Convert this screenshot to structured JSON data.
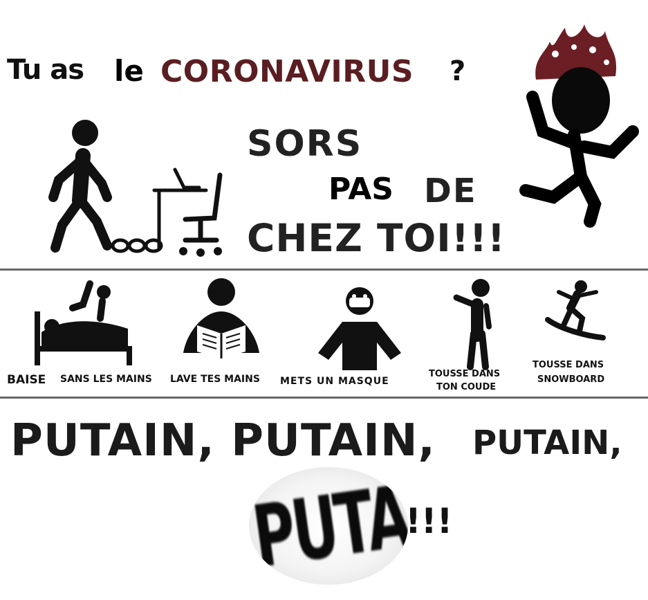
{
  "title": {
    "tu_as": "Tu as",
    "le": "le",
    "coronavirus": "CORONAVIRUS",
    "question_mark": "?"
  },
  "slogan": {
    "sors": "SORS",
    "pas": "PAS",
    "de": "DE",
    "chez_toi": "CHEZ TOI!!!"
  },
  "captions": {
    "baise": "BAISE",
    "sans_les_mains": "SANS LES MAINS",
    "lave_tes_mains": "LAVE TES MAINS",
    "mets_un_masque": "METS UN MASQUE",
    "tousse_dans_ton_coude_line1": "TOUSSE DANS",
    "tousse_dans_ton_coude_line2": "TON COUDE",
    "tousse_dans_snowboard_line1": "TOUSSE DANS",
    "tousse_dans_snowboard_line2": "SNOWBOARD"
  },
  "footer": {
    "putain_1": "PUTAIN, PUTAIN,",
    "putain_2": "PUTAIN,",
    "putain_warped": "PUTAIN,",
    "exclamations": "!!!"
  },
  "colors": {
    "coronavirus_text": "#5a1e22",
    "flame": "#6b1e24",
    "divider": "#666666",
    "pictogram": "#000000"
  },
  "icons": [
    "walking-man-icon",
    "chain-icon",
    "desk-chair-icon",
    "running-man-fire-icon",
    "bed-icon",
    "reading-book-icon",
    "masked-person-icon",
    "coughing-person-icon",
    "snowboarder-icon"
  ]
}
